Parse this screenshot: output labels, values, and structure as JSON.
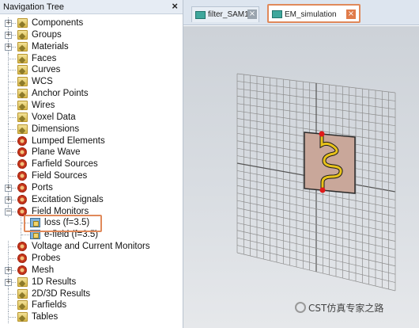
{
  "nav": {
    "title": "Navigation Tree",
    "close": "×",
    "items": [
      {
        "label": "Components",
        "toggle": "+",
        "icon": "folder-icon",
        "hasToggle": true
      },
      {
        "label": "Groups",
        "toggle": "+",
        "icon": "folder-icon",
        "hasToggle": true
      },
      {
        "label": "Materials",
        "toggle": "+",
        "icon": "folder-icon",
        "hasToggle": true
      },
      {
        "label": "Faces",
        "toggle": "",
        "icon": "folder-icon",
        "hasToggle": false
      },
      {
        "label": "Curves",
        "toggle": "",
        "icon": "folder-icon",
        "hasToggle": false
      },
      {
        "label": "WCS",
        "toggle": "",
        "icon": "folder-icon",
        "hasToggle": false
      },
      {
        "label": "Anchor Points",
        "toggle": "",
        "icon": "folder-icon",
        "hasToggle": false
      },
      {
        "label": "Wires",
        "toggle": "",
        "icon": "folder-icon",
        "hasToggle": false
      },
      {
        "label": "Voxel Data",
        "toggle": "",
        "icon": "folder-icon",
        "hasToggle": false
      },
      {
        "label": "Dimensions",
        "toggle": "",
        "icon": "folder-icon",
        "hasToggle": false
      },
      {
        "label": "Lumped Elements",
        "toggle": "",
        "icon": "red-gear-icon",
        "hasToggle": false
      },
      {
        "label": "Plane Wave",
        "toggle": "",
        "icon": "red-gear-icon",
        "hasToggle": false
      },
      {
        "label": "Farfield Sources",
        "toggle": "",
        "icon": "red-gear-icon",
        "hasToggle": false
      },
      {
        "label": "Field Sources",
        "toggle": "",
        "icon": "red-gear-icon",
        "hasToggle": false
      },
      {
        "label": "Ports",
        "toggle": "+",
        "icon": "red-gear-icon",
        "hasToggle": true
      },
      {
        "label": "Excitation Signals",
        "toggle": "+",
        "icon": "red-gear-icon",
        "hasToggle": true
      },
      {
        "label": "Field Monitors",
        "toggle": "−",
        "icon": "red-gear-icon",
        "hasToggle": true
      },
      {
        "label": "loss (f=3.5)",
        "toggle": "",
        "icon": "monitor-icon",
        "child": true
      },
      {
        "label": "e-field (f=3.5)",
        "toggle": "",
        "icon": "monitor-icon",
        "child": true
      },
      {
        "label": "Voltage and Current Monitors",
        "toggle": "",
        "icon": "red-gear-icon",
        "hasToggle": false
      },
      {
        "label": "Probes",
        "toggle": "",
        "icon": "red-gear-icon",
        "hasToggle": false
      },
      {
        "label": "Mesh",
        "toggle": "+",
        "icon": "red-gear-icon",
        "hasToggle": true
      },
      {
        "label": "1D Results",
        "toggle": "+",
        "icon": "folder-icon",
        "hasToggle": true
      },
      {
        "label": "2D/3D Results",
        "toggle": "",
        "icon": "folder-icon",
        "hasToggle": false
      },
      {
        "label": "Farfields",
        "toggle": "",
        "icon": "folder-icon",
        "hasToggle": false
      },
      {
        "label": "Tables",
        "toggle": "",
        "icon": "folder-icon",
        "hasToggle": false
      }
    ]
  },
  "tabs": [
    {
      "label": "filter_SAM1",
      "close": "×",
      "icon": "project-icon"
    },
    {
      "label": "EM_simulation",
      "close": "×",
      "icon": "project-icon"
    }
  ],
  "watermark": "CST仿真专家之路",
  "colors": {
    "highlight": "#e0895a",
    "substrate": "#c9a79a",
    "trace": "#e8c21a",
    "port": "#e01a1a"
  }
}
